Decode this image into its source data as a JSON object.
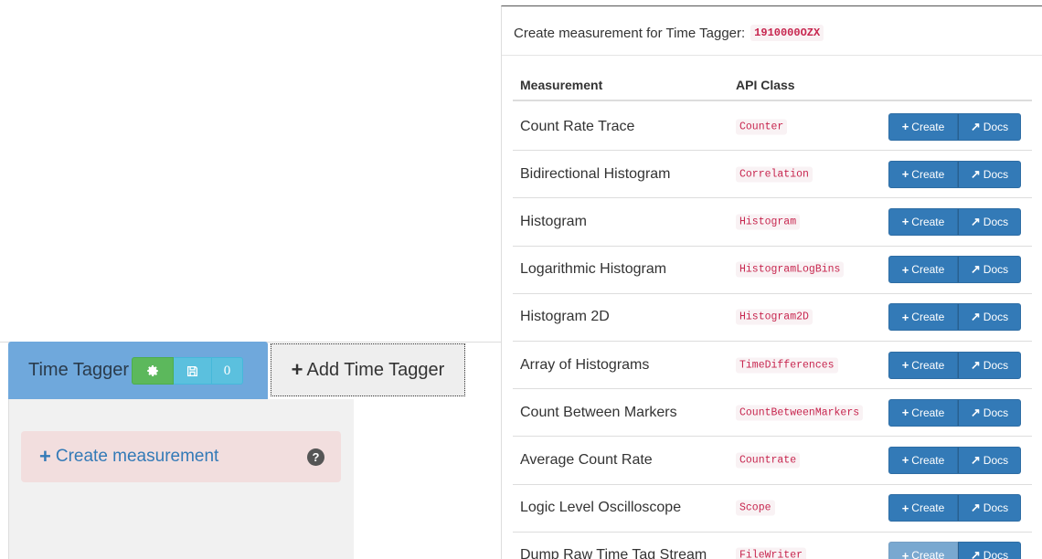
{
  "tabs": {
    "time_tagger_label": "Time Tagger",
    "gear_icon": "gear-icon",
    "save_icon": "floppy-disk-icon",
    "measurement_count": "0",
    "add_tab_plus": "+",
    "add_tab_label": "Add Time Tagger"
  },
  "left_panel": {
    "create_plus": "+",
    "create_label": "Create measurement",
    "help_icon_glyph": "?"
  },
  "dialog": {
    "title": "Create measurement for Time Tagger:",
    "serial": "1910000OZX",
    "columns": {
      "measurement": "Measurement",
      "api_class": "API Class"
    },
    "create_label": "Create",
    "docs_label": "Docs",
    "create_icon": "+",
    "docs_icon": "↗",
    "rows": [
      {
        "name": "Count Rate Trace",
        "api": "Counter"
      },
      {
        "name": "Bidirectional Histogram",
        "api": "Correlation"
      },
      {
        "name": "Histogram",
        "api": "Histogram"
      },
      {
        "name": "Logarithmic Histogram",
        "api": "HistogramLogBins"
      },
      {
        "name": "Histogram 2D",
        "api": "Histogram2D"
      },
      {
        "name": "Array of Histograms",
        "api": "TimeDifferences"
      },
      {
        "name": "Count Between Markers",
        "api": "CountBetweenMarkers"
      },
      {
        "name": "Average Count Rate",
        "api": "Countrate"
      },
      {
        "name": "Logic Level Oscilloscope",
        "api": "Scope"
      },
      {
        "name": "Dump Raw Time Tag Stream",
        "api": "FileWriter",
        "create_disabled": true
      }
    ]
  },
  "colors": {
    "primary": "#337ab7",
    "success": "#5cb85c",
    "info": "#5bc0de",
    "tab_active": "#6fa8dc",
    "code_text": "#c7254e",
    "danger_bg": "#f2dede"
  }
}
